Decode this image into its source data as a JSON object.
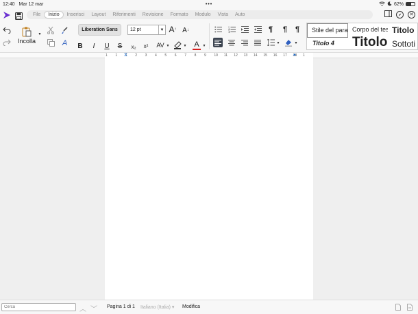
{
  "status": {
    "time": "12:40",
    "date": "Mar 12 mar",
    "dots": "•••",
    "battery": "62%",
    "battery_level": 0.62
  },
  "menu": {
    "tabs": [
      "File",
      "Inizio",
      "Inserisci",
      "Layout",
      "Riferimenti",
      "Revisione",
      "Formato",
      "Modulo",
      "Vista",
      "Auto"
    ],
    "active_tab": "Inizio"
  },
  "toolbar": {
    "paste_label": "Incolla",
    "font_name": "Liberation Sans",
    "font_size": "12 pt",
    "bold": "B",
    "italic": "I",
    "underline": "U",
    "strike": "S",
    "subscript": "x₂",
    "superscript": "x²",
    "spacing": "AV",
    "grow_font": "A",
    "shrink_font": "A",
    "font_color": "A",
    "pilcrow": "¶"
  },
  "styles": {
    "items": [
      "Stile del para",
      "Corpo del tes",
      "Titolo",
      "Titolo 4",
      "Titolo",
      "Sottoti"
    ]
  },
  "ruler": {
    "numbers": [
      "1",
      "1",
      "1",
      "2",
      "3",
      "4",
      "5",
      "6",
      "7",
      "8",
      "9",
      "10",
      "11",
      "12",
      "13",
      "14",
      "15",
      "16",
      "17",
      "18",
      "1"
    ]
  },
  "bottom": {
    "search_placeholder": "Cerca",
    "page_info": "Pagina 1 di 1",
    "language": "Italiano (Italia)",
    "mode": "Modifica"
  },
  "colors": {
    "accent": "#6a2fd0",
    "font_color": "#d62020"
  }
}
